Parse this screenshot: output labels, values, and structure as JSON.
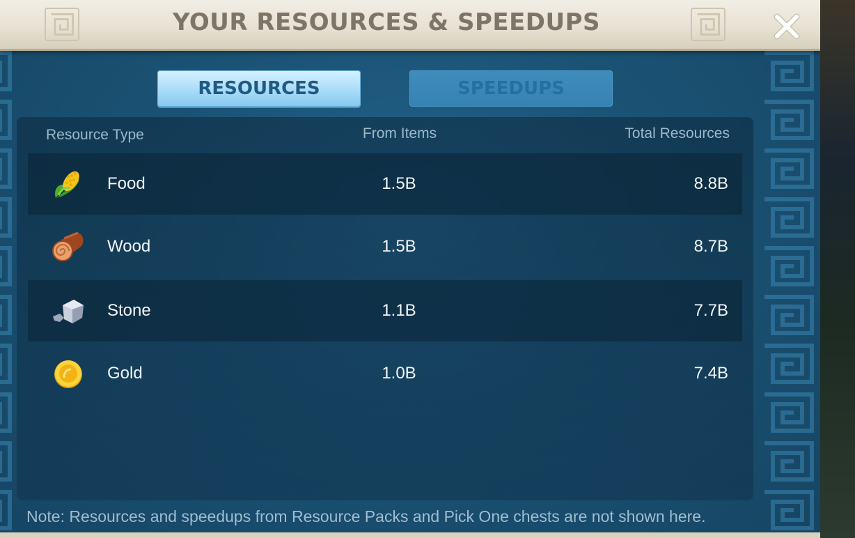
{
  "window": {
    "title": "YOUR RESOURCES & SPEEDUPS",
    "close_icon": "close-x-icon"
  },
  "tabs": [
    {
      "label": "RESOURCES",
      "active": true
    },
    {
      "label": "SPEEDUPS",
      "active": false
    }
  ],
  "table": {
    "headers": {
      "type": "Resource Type",
      "from_items": "From Items",
      "total": "Total Resources"
    },
    "rows": [
      {
        "icon": "corn-icon",
        "name": "Food",
        "from_items": "1.5B",
        "total": "8.8B"
      },
      {
        "icon": "log-icon",
        "name": "Wood",
        "from_items": "1.5B",
        "total": "8.7B"
      },
      {
        "icon": "stone-icon",
        "name": "Stone",
        "from_items": "1.1B",
        "total": "7.7B"
      },
      {
        "icon": "gold-coin-icon",
        "name": "Gold",
        "from_items": "1.0B",
        "total": "7.4B"
      }
    ]
  },
  "note": "Note: Resources and speedups from Resource Packs and Pick One chests are not shown here.",
  "colors": {
    "title_bar": "#e9e4d6",
    "panel_blue": "#1b5274",
    "active_tab": "#a9dcf8",
    "inactive_tab": "#3682b3"
  }
}
